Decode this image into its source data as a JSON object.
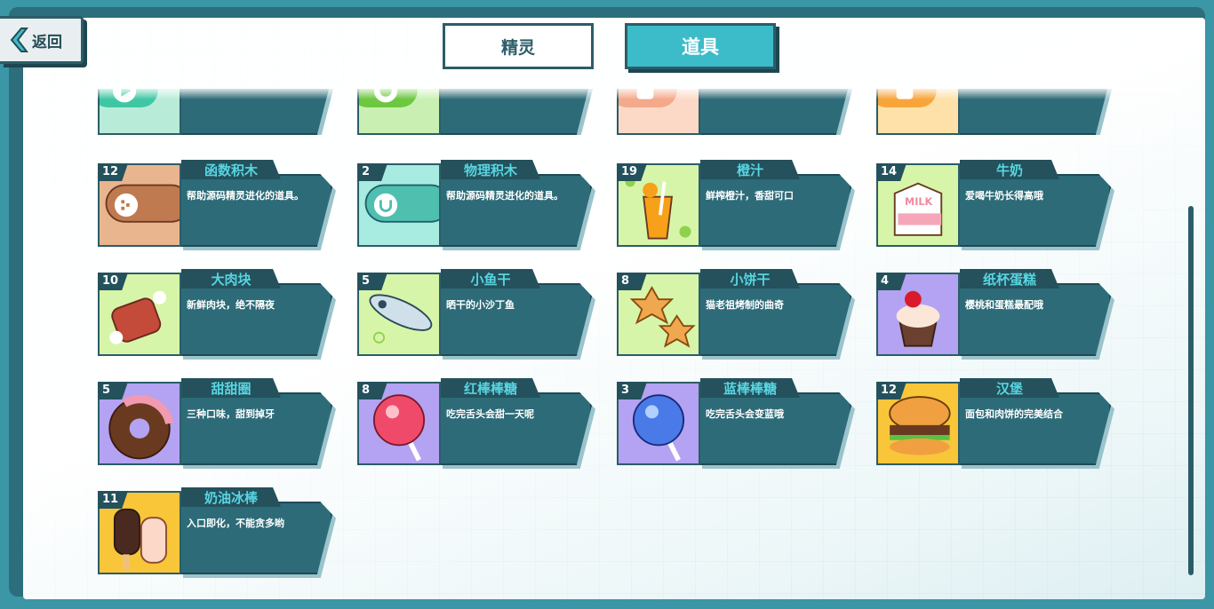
{
  "header": {
    "back_label": "返回",
    "tabs": [
      {
        "label": "精灵",
        "active": false
      },
      {
        "label": "道具",
        "active": true
      }
    ]
  },
  "colors": {
    "accent": "#3cbcc8",
    "card_body": "#2d6b78",
    "name_text": "#57d6e2",
    "dark": "#24515c"
  },
  "items": [
    {
      "name": "",
      "count": "",
      "desc": "",
      "icon": "pen-block-icon",
      "bg": "#b8ecd8"
    },
    {
      "name": "",
      "count": "",
      "desc": "",
      "icon": "sensor-block-icon",
      "bg": "#c9f0b2"
    },
    {
      "name": "",
      "count": "",
      "desc": "",
      "icon": "operator-block-icon",
      "bg": "#fcd9c6"
    },
    {
      "name": "",
      "count": "",
      "desc": "",
      "icon": "data-block-icon",
      "bg": "#fde1a8"
    },
    {
      "name": "函数积木",
      "count": "12",
      "desc": "帮助源码精灵进化的道具。",
      "icon": "procedure-block-icon",
      "bg": "#e9b58f"
    },
    {
      "name": "物理积木",
      "count": "2",
      "desc": "帮助源码精灵进化的道具。",
      "icon": "physics-block-icon",
      "bg": "#a7ebe1"
    },
    {
      "name": "橙汁",
      "count": "19",
      "desc": "鲜榨橙汁，香甜可口",
      "icon": "orange-juice-icon",
      "bg": "#d7f5a8"
    },
    {
      "name": "牛奶",
      "count": "14",
      "desc": "爱喝牛奶长得高哦",
      "icon": "milk-icon",
      "bg": "#d7f5a8"
    },
    {
      "name": "大肉块",
      "count": "10",
      "desc": "新鲜肉块，绝不隔夜",
      "icon": "meat-icon",
      "bg": "#d7f5a8"
    },
    {
      "name": "小鱼干",
      "count": "5",
      "desc": "晒干的小沙丁鱼",
      "icon": "dried-fish-icon",
      "bg": "#d7f5a8"
    },
    {
      "name": "小饼干",
      "count": "8",
      "desc": "猫老祖烤制的曲奇",
      "icon": "cookie-icon",
      "bg": "#d7f5a8"
    },
    {
      "name": "纸杯蛋糕",
      "count": "4",
      "desc": "樱桃和蛋糕最配哦",
      "icon": "cupcake-icon",
      "bg": "#b3a3f2"
    },
    {
      "name": "甜甜圈",
      "count": "5",
      "desc": "三种口味，甜到掉牙",
      "icon": "donut-icon",
      "bg": "#b3a3f2"
    },
    {
      "name": "红棒棒糖",
      "count": "8",
      "desc": "吃完舌头会甜一天呢",
      "icon": "red-lollipop-icon",
      "bg": "#b3a3f2"
    },
    {
      "name": "蓝棒棒糖",
      "count": "3",
      "desc": "吃完舌头会变蓝哦",
      "icon": "blue-lollipop-icon",
      "bg": "#b3a3f2"
    },
    {
      "name": "汉堡",
      "count": "12",
      "desc": "面包和肉饼的完美结合",
      "icon": "burger-icon",
      "bg": "#f9c63a"
    },
    {
      "name": "奶油冰棒",
      "count": "11",
      "desc": "入口即化，不能贪多哟",
      "icon": "ice-cream-bar-icon",
      "bg": "#f9c63a"
    }
  ]
}
